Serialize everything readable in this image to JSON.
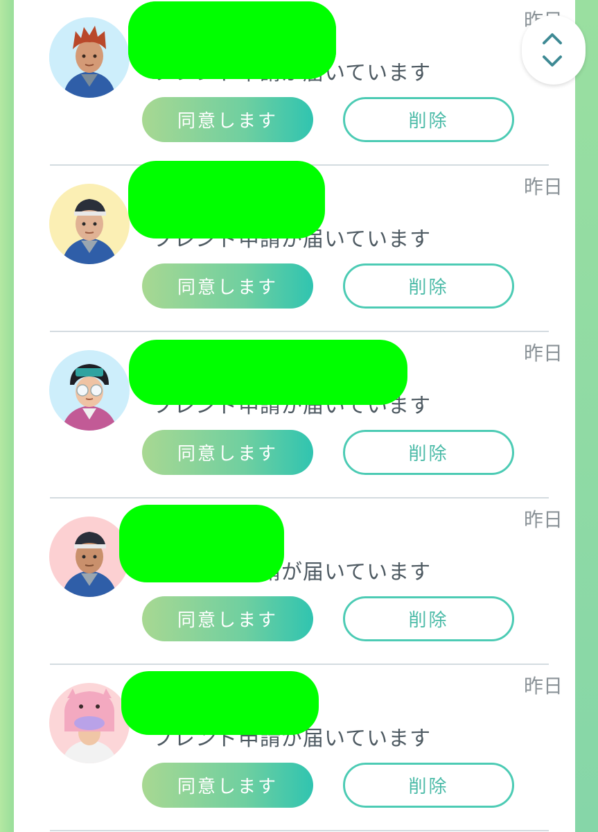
{
  "requests": [
    {
      "date": "昨日",
      "message": "フレンド申請が届いています",
      "accept_label": "同意します",
      "delete_label": "削除",
      "avatar": "trainer-avatar-red-hair"
    },
    {
      "date": "昨日",
      "message": "フレンド申請が届いています",
      "accept_label": "同意します",
      "delete_label": "削除",
      "avatar": "trainer-avatar-cap"
    },
    {
      "date": "昨日",
      "message": "フレンド申請が届いています",
      "accept_label": "同意します",
      "delete_label": "削除",
      "avatar": "trainer-avatar-sunglasses"
    },
    {
      "date": "昨日",
      "message": "フレンド申請が届いています",
      "accept_label": "同意します",
      "delete_label": "削除",
      "avatar": "trainer-avatar-cap-pink-bg"
    },
    {
      "date": "昨日",
      "message": "フレンド申請が届いています",
      "accept_label": "同意します",
      "delete_label": "削除",
      "avatar": "trainer-avatar-slowpoke-hat"
    }
  ],
  "icons": {
    "scroll": "chevron-up-down-icon"
  },
  "colors": {
    "accent": "#4ccbb4",
    "redaction": "#00ff00",
    "text": "#4e5a62",
    "muted": "#8a9297"
  }
}
